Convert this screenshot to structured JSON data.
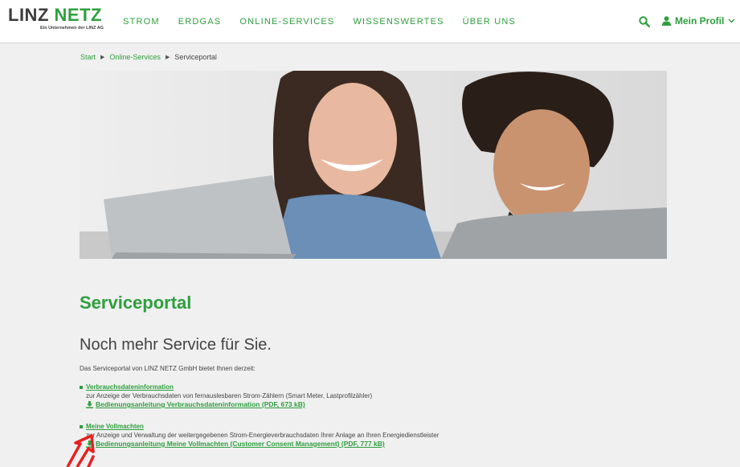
{
  "header": {
    "logo": {
      "main_1": "LINZ",
      "main_2": "NETZ",
      "sub": "Ein Unternehmen der LINZ AG"
    },
    "nav": [
      "STROM",
      "ERDGAS",
      "ONLINE-SERVICES",
      "WISSENSWERTES",
      "ÜBER UNS"
    ],
    "profile_label": "Mein Profil"
  },
  "breadcrumb": {
    "items": [
      "Start",
      "Online-Services"
    ],
    "current": "Serviceportal"
  },
  "main": {
    "title": "Serviceportal",
    "subtitle": "Noch mehr Service für Sie.",
    "intro": "Das Serviceportal von LINZ NETZ GmbH bietet Ihnen derzeit:",
    "services": [
      {
        "title": "Verbrauchsdateninformation",
        "desc": "zur Anzeige der Verbrauchsdaten von fernauslesbaren Strom-Zählern (Smart Meter, Lastprofilzähler)",
        "download": "Bedienungsanleitung Verbrauchsdateninformation (PDF, 673 kB)"
      },
      {
        "title": "Meine Vollmachten",
        "desc": "zur Anzeige und Verwaltung der weitergegebenen Strom-Energieverbrauchsdaten Ihrer Anlage an Ihren Energiedienstleister",
        "download": "Bedienungsanleitung Meine Vollmachten (Customer Consent Management) (PDF, 777 kB)"
      }
    ]
  },
  "colors": {
    "brand": "#2e9f3e",
    "annotation": "#e8201f"
  }
}
